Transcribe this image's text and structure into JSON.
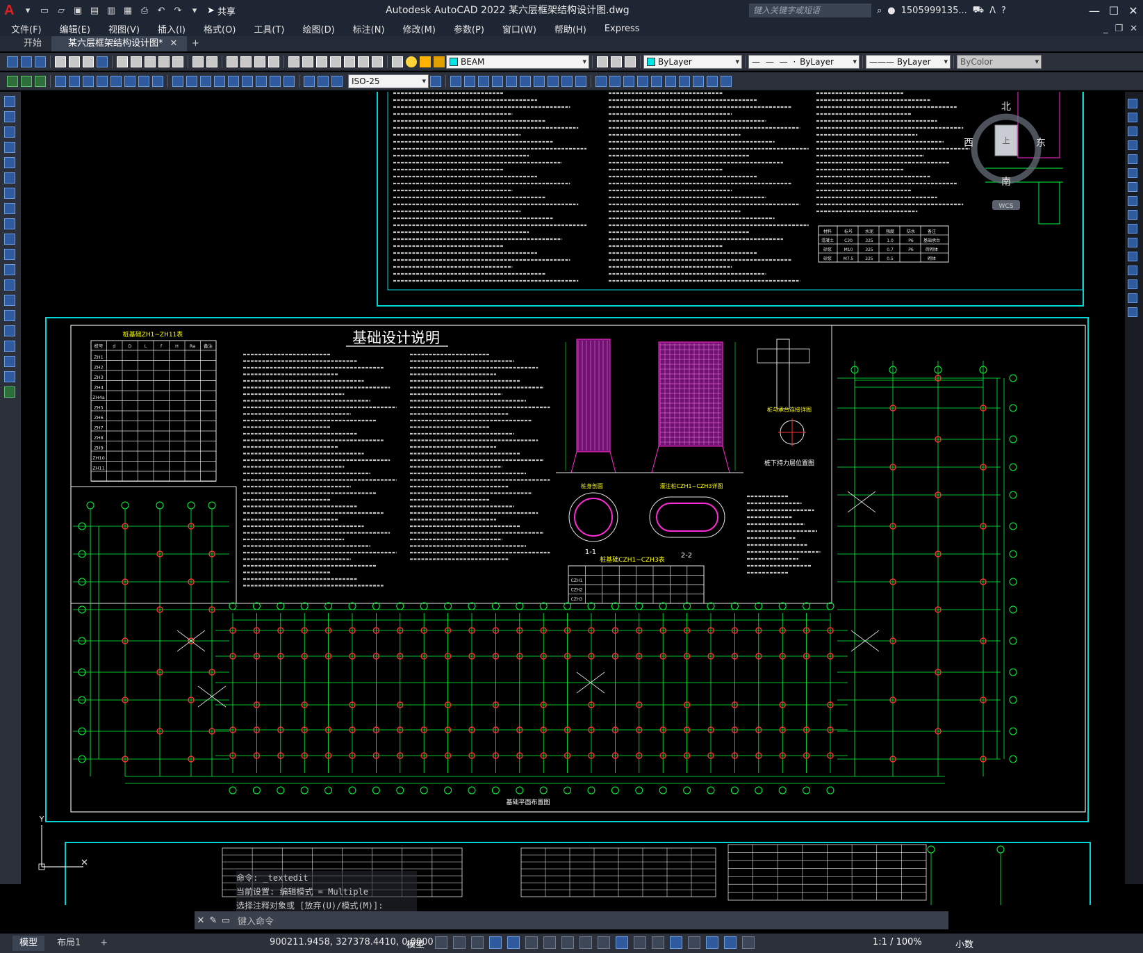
{
  "app": {
    "title": "Autodesk AutoCAD 2022    某六层框架结构设计图.dwg",
    "share_label": "共享",
    "search_placeholder": "键入关键字或短语",
    "username": "1505999135...",
    "logo_letter": "A"
  },
  "menu": [
    "文件(F)",
    "编辑(E)",
    "视图(V)",
    "插入(I)",
    "格式(O)",
    "工具(T)",
    "绘图(D)",
    "标注(N)",
    "修改(M)",
    "参数(P)",
    "窗口(W)",
    "帮助(H)",
    "Express"
  ],
  "file_tabs": [
    {
      "label": "开始",
      "active": false
    },
    {
      "label": "某六层框架结构设计图*",
      "active": true
    }
  ],
  "toolbar": {
    "layer_name": "BEAM",
    "color": "ByLayer",
    "linetype": "ByLayer",
    "lineweight": "ByLayer",
    "plotstyle": "ByColor",
    "dimstyle": "ISO-25",
    "layer_color": "#00e5e5",
    "bylayer_color": "#00e5e5"
  },
  "viewcube": {
    "north": "北",
    "south": "南",
    "east": "东",
    "west": "西",
    "top": "上",
    "wcs": "WCS"
  },
  "drawing": {
    "title_foundation": "基础设计说明",
    "plan_title": "基础平面布置图",
    "table_title_zh": "桩基础ZH1~ZH11表",
    "table_title_czh": "桩基础CZH1~CZH3表",
    "section_1": "1-1",
    "section_2": "2-2",
    "detail_1": "桩身剖面",
    "detail_2": "桩与承台连接详图",
    "detail_3": "桩下持力层位置图",
    "detail_4": "灌注桩CZH1~CZH3详图",
    "table_headers": [
      "桩号",
      "d",
      "D",
      "L",
      "f",
      "H",
      "Ra",
      "备注"
    ],
    "zh_rows": [
      "ZH1",
      "ZH2",
      "ZH3",
      "ZH4",
      "ZH4a",
      "ZH5",
      "ZH6",
      "ZH7",
      "ZH8",
      "ZH9",
      "ZH10",
      "ZH11"
    ],
    "czh_rows": [
      "CZH1",
      "CZH2",
      "CZH3"
    ],
    "legend_rows": [
      [
        "材料",
        "标号",
        "水泥",
        "强度",
        "防水",
        "备注"
      ],
      [
        "混凝土",
        "C30",
        "325",
        "1.0",
        "P6",
        "基础承台"
      ],
      [
        "砂浆",
        "M10",
        "325",
        "0.7",
        "P6",
        "砖砌体"
      ],
      [
        "砂浆",
        "M7.5",
        "225",
        "0.5",
        "",
        "砌体"
      ]
    ]
  },
  "command": {
    "history": [
      "命令: _textedit",
      "当前设置: 编辑模式 = Multiple",
      "选择注释对象或 [放弃(U)/模式(M)]:"
    ],
    "placeholder": "键入命令"
  },
  "status": {
    "layout_tabs": [
      {
        "label": "模型",
        "active": true
      },
      {
        "label": "布局1",
        "active": false
      }
    ],
    "coordinates": "900211.9458, 327378.4410, 0.0000",
    "model": "模型",
    "scale": "1:1 / 100%",
    "units": "小数"
  }
}
